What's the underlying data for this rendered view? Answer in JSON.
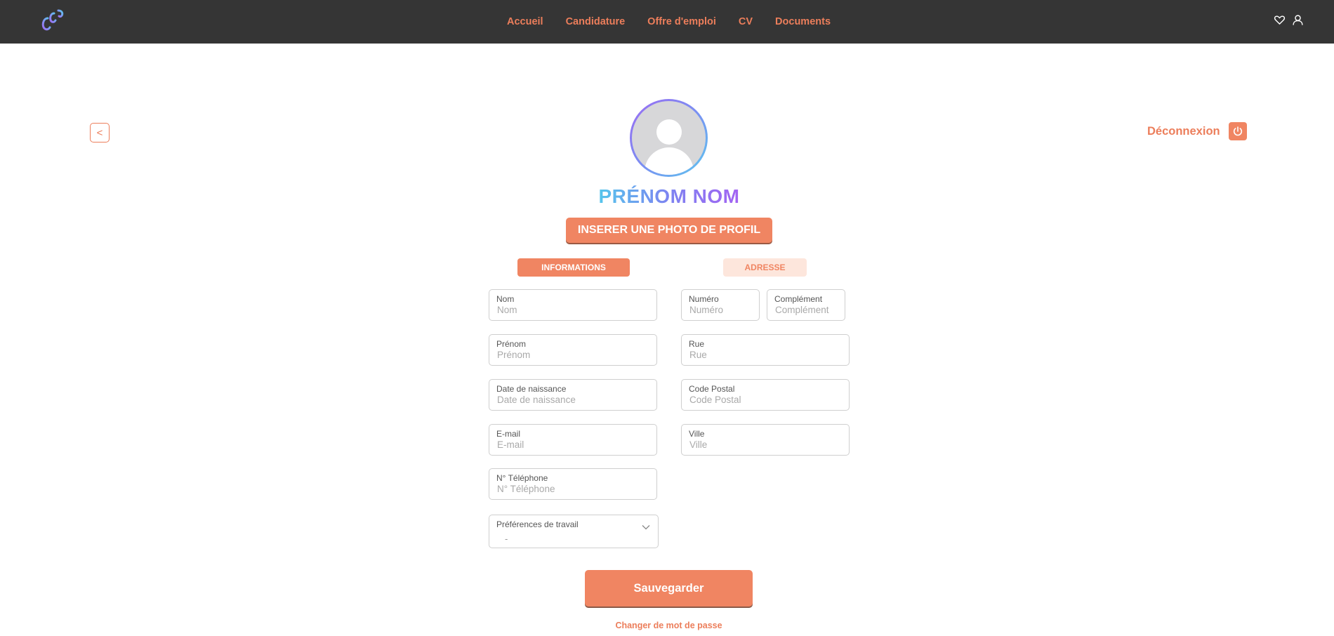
{
  "nav": {
    "links": [
      "Accueil",
      "Candidature",
      "Offre d'emploi",
      "CV",
      "Documents"
    ]
  },
  "back_label": "<",
  "logout_label": "Déconnexion",
  "profile": {
    "name": "PRÉNOM NOM",
    "photo_button": "INSERER UNE PHOTO DE PROFIL"
  },
  "tabs": {
    "informations": "INFORMATIONS",
    "adresse": "ADRESSE"
  },
  "info_fields": {
    "nom": {
      "label": "Nom",
      "placeholder": "Nom"
    },
    "prenom": {
      "label": "Prénom",
      "placeholder": "Prénom"
    },
    "naissance": {
      "label": "Date de naissance",
      "placeholder": "Date de naissance"
    },
    "email": {
      "label": "E-mail",
      "placeholder": "E-mail"
    },
    "telephone": {
      "label": "N° Téléphone",
      "placeholder": "N° Téléphone"
    },
    "preferences": {
      "label": "Préférences de travail",
      "value": "-"
    }
  },
  "address_fields": {
    "numero": {
      "label": "Numéro",
      "placeholder": "Numéro"
    },
    "complement": {
      "label": "Complément",
      "placeholder": "Complément"
    },
    "rue": {
      "label": "Rue",
      "placeholder": "Rue"
    },
    "code_postal": {
      "label": "Code Postal",
      "placeholder": "Code Postal"
    },
    "ville": {
      "label": "Ville",
      "placeholder": "Ville"
    }
  },
  "save_label": "Sauvegarder",
  "password_link": "Changer de mot de passe",
  "colors": {
    "accent": "#f08562",
    "header_bg": "#353535",
    "gradient_start": "#56c5ec",
    "gradient_end": "#a463f2"
  },
  "icons": {
    "logo": "logo-icon",
    "favorites": "heart-icon",
    "account": "user-icon",
    "logout": "power-icon",
    "dropdown": "chevron-down-icon"
  }
}
